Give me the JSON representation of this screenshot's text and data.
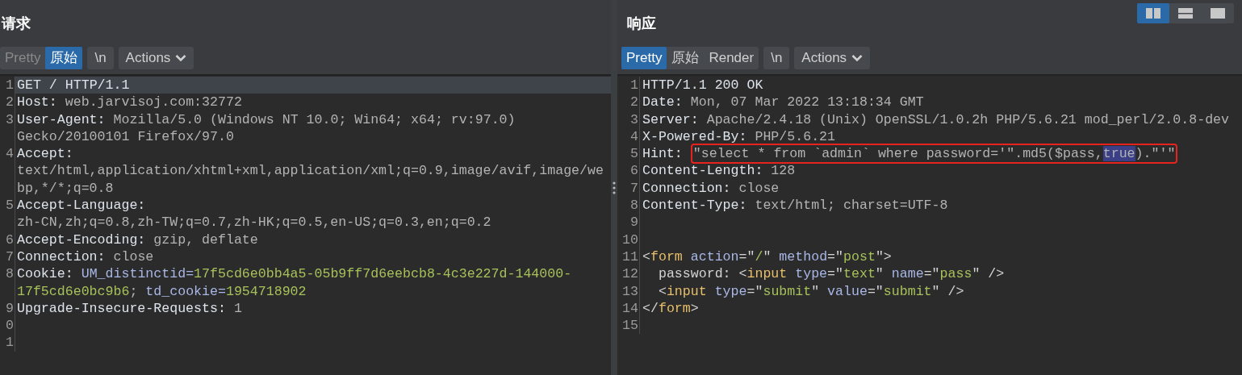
{
  "layout_buttons": [
    {
      "kind": "columns",
      "selected": true
    },
    {
      "kind": "rows",
      "selected": false
    },
    {
      "kind": "single",
      "selected": false
    }
  ],
  "panes": [
    {
      "title": "请求",
      "view_tabs": [
        {
          "label": "Pretty",
          "selected": false,
          "disabled": true
        },
        {
          "label": "原始",
          "selected": true,
          "disabled": false
        }
      ],
      "newline_button": "\\n",
      "actions_button": "Actions",
      "lines": [
        {
          "num": "1",
          "current": true,
          "segments": [
            {
              "kind": "key",
              "text": "GET / HTTP/1.1"
            }
          ]
        },
        {
          "num": "2",
          "current": false,
          "segments": [
            {
              "kind": "key",
              "text": "Host:"
            },
            {
              "kind": "value",
              "text": " web.jarvisoj.com:32772"
            }
          ]
        },
        {
          "num": "3",
          "current": false,
          "segments": [
            {
              "kind": "key",
              "text": "User-Agent:"
            },
            {
              "kind": "value",
              "text": " Mozilla/5.0 (Windows NT 10.0; Win64; x64; rv:97.0) Gecko/20100101 Firefox/97.0"
            }
          ]
        },
        {
          "num": "4",
          "current": false,
          "segments": [
            {
              "kind": "key",
              "text": "Accept:"
            },
            {
              "kind": "value",
              "text": " text/html,application/xhtml+xml,application/xml;q=0.9,image/avif,image/webp,*/*;q=0.8"
            }
          ]
        },
        {
          "num": "5",
          "current": false,
          "segments": [
            {
              "kind": "key",
              "text": "Accept-Language:"
            },
            {
              "kind": "value",
              "text": " zh-CN,zh;q=0.8,zh-TW;q=0.7,zh-HK;q=0.5,en-US;q=0.3,en;q=0.2"
            }
          ]
        },
        {
          "num": "6",
          "current": false,
          "segments": [
            {
              "kind": "key",
              "text": "Accept-Encoding:"
            },
            {
              "kind": "value",
              "text": " gzip, deflate"
            }
          ]
        },
        {
          "num": "7",
          "current": false,
          "segments": [
            {
              "kind": "key",
              "text": "Connection:"
            },
            {
              "kind": "value",
              "text": " close"
            }
          ]
        },
        {
          "num": "8",
          "current": false,
          "segments": [
            {
              "kind": "key",
              "text": "Cookie: "
            },
            {
              "kind": "attr",
              "text": "UM_distinctid="
            },
            {
              "kind": "str",
              "text": "17f5cd6e0bb4a5-05b9ff7d6eebcb8-4c3e227d-144000-17f5cd6e0bc9b6"
            },
            {
              "kind": "value",
              "text": "; "
            },
            {
              "kind": "attr",
              "text": "td_cookie="
            },
            {
              "kind": "str",
              "text": "1954718902"
            }
          ]
        },
        {
          "num": "9",
          "current": false,
          "segments": [
            {
              "kind": "key",
              "text": "Upgrade-Insecure-Requests:"
            },
            {
              "kind": "value",
              "text": " 1"
            }
          ]
        },
        {
          "num": "0",
          "current": false
        },
        {
          "num": "1",
          "current": false
        }
      ]
    },
    {
      "title": "响应",
      "view_tabs": [
        {
          "label": "Pretty",
          "selected": true,
          "disabled": false
        },
        {
          "label": "原始",
          "selected": false,
          "disabled": false
        },
        {
          "label": "Render",
          "selected": false,
          "disabled": false
        }
      ],
      "newline_button": "\\n",
      "actions_button": "Actions",
      "lines": [
        {
          "num": "1",
          "current": false,
          "segments": [
            {
              "kind": "key",
              "text": "HTTP/1.1 200 OK"
            }
          ]
        },
        {
          "num": "2",
          "current": false,
          "segments": [
            {
              "kind": "key",
              "text": "Date:"
            },
            {
              "kind": "value",
              "text": " Mon, 07 Mar 2022 13:18:34 GMT"
            }
          ]
        },
        {
          "num": "3",
          "current": false,
          "segments": [
            {
              "kind": "key",
              "text": "Server:"
            },
            {
              "kind": "value",
              "text": " Apache/2.4.18 (Unix) OpenSSL/1.0.2h PHP/5.6.21 mod_perl/2.0.8-dev"
            }
          ]
        },
        {
          "num": "4",
          "current": false,
          "segments": [
            {
              "kind": "key",
              "text": "X-Powered-By:"
            },
            {
              "kind": "value",
              "text": " PHP/5.6.21"
            }
          ]
        },
        {
          "num": "5",
          "current": false,
          "segments": [
            {
              "kind": "key",
              "text": "Hint: "
            },
            {
              "kind": "value",
              "text": "\"select * from `admin` where password='\".md5($pass,",
              "boxed": true
            },
            {
              "kind": "value",
              "text": "true",
              "boxed": true,
              "selected": true
            },
            {
              "kind": "value",
              "text": ").\"'\"",
              "boxed": true
            }
          ]
        },
        {
          "num": "6",
          "current": false,
          "segments": [
            {
              "kind": "key",
              "text": "Content-Length:"
            },
            {
              "kind": "value",
              "text": " 128"
            }
          ]
        },
        {
          "num": "7",
          "current": false,
          "segments": [
            {
              "kind": "key",
              "text": "Connection:"
            },
            {
              "kind": "value",
              "text": " close"
            }
          ]
        },
        {
          "num": "8",
          "current": false,
          "segments": [
            {
              "kind": "key",
              "text": "Content-Type:"
            },
            {
              "kind": "value",
              "text": " text/html; charset=UTF-8"
            }
          ]
        },
        {
          "num": "9",
          "current": false
        },
        {
          "num": "10",
          "current": false
        },
        {
          "num": "11",
          "current": false,
          "segments": [
            {
              "kind": "punct",
              "text": "<"
            },
            {
              "kind": "tag",
              "text": "form"
            },
            {
              "kind": "attr",
              "text": " action"
            },
            {
              "kind": "punct",
              "text": "=\""
            },
            {
              "kind": "str",
              "text": "/"
            },
            {
              "kind": "punct",
              "text": "\" "
            },
            {
              "kind": "attr",
              "text": "method"
            },
            {
              "kind": "punct",
              "text": "=\""
            },
            {
              "kind": "str",
              "text": "post"
            },
            {
              "kind": "punct",
              "text": "\">"
            }
          ]
        },
        {
          "num": "12",
          "current": false,
          "segments": [
            {
              "kind": "punct",
              "text": "  password: <"
            },
            {
              "kind": "tag",
              "text": "input"
            },
            {
              "kind": "attr",
              "text": " type"
            },
            {
              "kind": "punct",
              "text": "=\""
            },
            {
              "kind": "str",
              "text": "text"
            },
            {
              "kind": "punct",
              "text": "\" "
            },
            {
              "kind": "attr",
              "text": "name"
            },
            {
              "kind": "punct",
              "text": "=\""
            },
            {
              "kind": "str",
              "text": "pass"
            },
            {
              "kind": "punct",
              "text": "\" />"
            }
          ]
        },
        {
          "num": "13",
          "current": false,
          "segments": [
            {
              "kind": "punct",
              "text": "  <"
            },
            {
              "kind": "tag",
              "text": "input"
            },
            {
              "kind": "attr",
              "text": " type"
            },
            {
              "kind": "punct",
              "text": "=\""
            },
            {
              "kind": "str",
              "text": "submit"
            },
            {
              "kind": "punct",
              "text": "\" "
            },
            {
              "kind": "attr",
              "text": "value"
            },
            {
              "kind": "punct",
              "text": "=\""
            },
            {
              "kind": "str",
              "text": "submit"
            },
            {
              "kind": "punct",
              "text": "\" />"
            }
          ]
        },
        {
          "num": "14",
          "current": false,
          "segments": [
            {
              "kind": "punct",
              "text": "</"
            },
            {
              "kind": "tag",
              "text": "form"
            },
            {
              "kind": "punct",
              "text": ">"
            }
          ]
        },
        {
          "num": "15",
          "current": false
        }
      ]
    }
  ]
}
